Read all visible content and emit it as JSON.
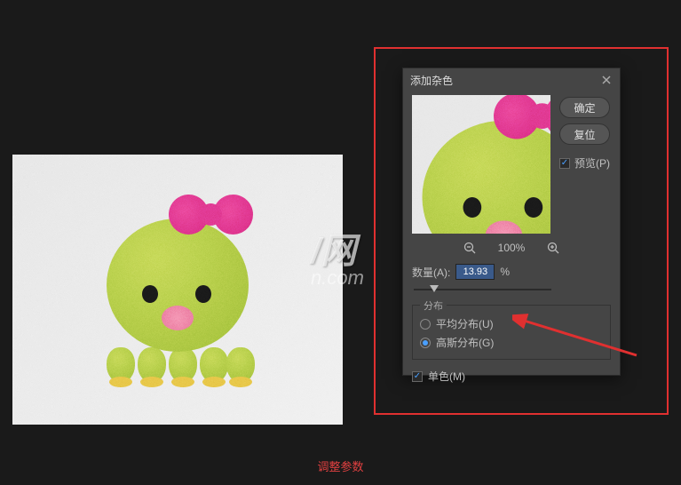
{
  "dialog": {
    "title": "添加杂色",
    "ok_label": "确定",
    "reset_label": "复位",
    "preview_label": "预览(P)",
    "zoom_percent": "100%",
    "amount_label": "数量(A):",
    "amount_value": "13.93",
    "amount_unit": "%",
    "distribution_legend": "分布",
    "uniform_label": "平均分布(U)",
    "gaussian_label": "高斯分布(G)",
    "monochrome_label": "单色(M)",
    "preview_checked": true,
    "distribution_selected": "gaussian",
    "monochrome_checked": true
  },
  "watermark": {
    "main": "/网",
    "sub": "n.com"
  },
  "annotation": {
    "bottom_text": "调整参数"
  }
}
